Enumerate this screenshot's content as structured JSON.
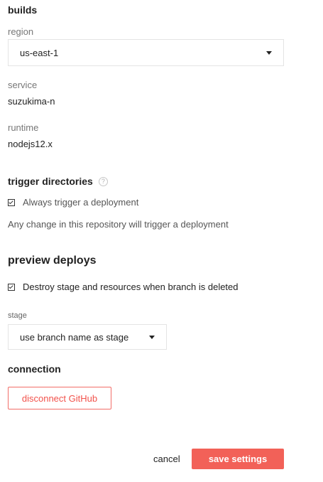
{
  "builds": {
    "title": "builds",
    "region": {
      "label": "region",
      "value": "us-east-1"
    },
    "service": {
      "label": "service",
      "value": "suzukima-n"
    },
    "runtime": {
      "label": "runtime",
      "value": "nodejs12.x"
    }
  },
  "trigger": {
    "title": "trigger directories",
    "help_icon": "?",
    "always_trigger_label": "Always trigger a deployment",
    "always_trigger_checked": true,
    "helper": "Any change in this repository will trigger a deployment"
  },
  "preview": {
    "title": "preview deploys",
    "destroy_label": "Destroy stage and resources when branch is deleted",
    "destroy_checked": true,
    "stage": {
      "label": "stage",
      "value": "use branch name as stage"
    }
  },
  "connection": {
    "title": "connection",
    "disconnect_label": "disconnect GitHub"
  },
  "footer": {
    "cancel_label": "cancel",
    "save_label": "save settings"
  },
  "colors": {
    "accent": "#f26158",
    "danger_text": "#f2524b"
  },
  "icons": {
    "help": "question-circle-icon",
    "caret": "caret-down-icon",
    "checkbox": "checkbox-checked-icon"
  }
}
